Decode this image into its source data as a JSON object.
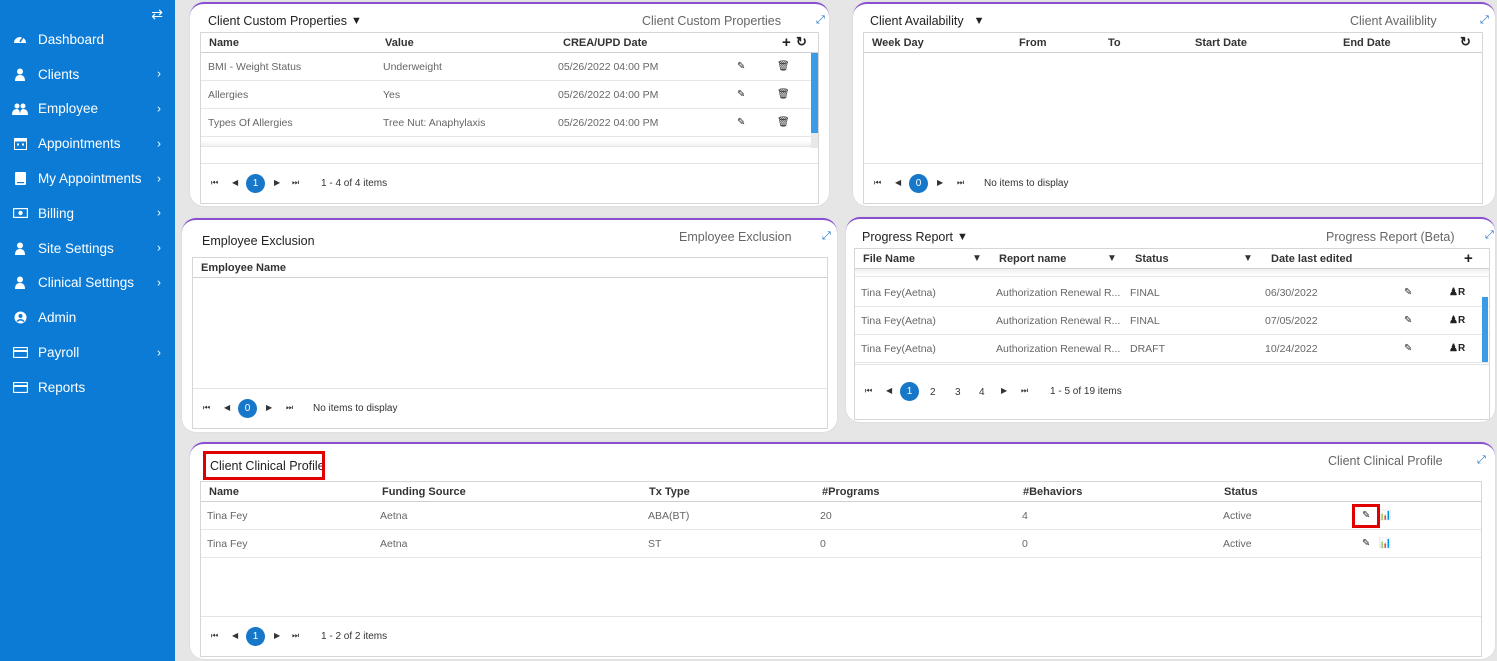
{
  "sidebar": {
    "toggle_icon": "swap-arrows-icon",
    "items": [
      {
        "label": "Dashboard",
        "icon": "dashboard-icon",
        "chevron": false
      },
      {
        "label": "Clients",
        "icon": "user-icon",
        "chevron": true
      },
      {
        "label": "Employee",
        "icon": "users-icon",
        "chevron": true
      },
      {
        "label": "Appointments",
        "icon": "calendar-icon",
        "chevron": true
      },
      {
        "label": "My Appointments",
        "icon": "book-icon",
        "chevron": true
      },
      {
        "label": "Billing",
        "icon": "money-icon",
        "chevron": true
      },
      {
        "label": "Site Settings",
        "icon": "user-icon",
        "chevron": true
      },
      {
        "label": "Clinical Settings",
        "icon": "user-icon",
        "chevron": true
      },
      {
        "label": "Admin",
        "icon": "user-circle-icon",
        "chevron": false
      },
      {
        "label": "Payroll",
        "icon": "credit-card-icon",
        "chevron": true
      },
      {
        "label": "Reports",
        "icon": "credit-card-icon",
        "chevron": false
      }
    ]
  },
  "custom_props": {
    "title": "Client Custom Properties",
    "right_title": "Client Custom Properties",
    "columns": [
      "Name",
      "Value",
      "CREA/UPD Date"
    ],
    "rows": [
      [
        "BMI - Weight Status",
        "Underweight",
        "05/26/2022 04:00 PM"
      ],
      [
        "Allergies",
        "Yes",
        "05/26/2022 04:00 PM"
      ],
      [
        "Types Of Allergies",
        "Tree Nut: Anaphylaxis",
        "05/26/2022 04:00 PM"
      ]
    ],
    "page": "1",
    "info": "1 - 4 of 4 items"
  },
  "availability": {
    "title": "Client Availability",
    "right_title": "Client Availiblity",
    "columns": [
      "Week Day",
      "From",
      "To",
      "Start Date",
      "End Date"
    ],
    "page": "0",
    "info": "No items to display"
  },
  "exclusion": {
    "title": "Employee Exclusion",
    "right_title": "Employee Exclusion",
    "columns": [
      "Employee Name"
    ],
    "page": "0",
    "info": "No items to display"
  },
  "progress": {
    "title": "Progress Report",
    "right_title": "Progress Report (Beta)",
    "columns": [
      "File Name",
      "Report name",
      "Status",
      "Date last edited"
    ],
    "rows": [
      [
        "Tina Fey(Aetna)",
        "Authorization Renewal R...",
        "FINAL",
        "06/30/2022"
      ],
      [
        "Tina Fey(Aetna)",
        "Authorization Renewal R...",
        "FINAL",
        "07/05/2022"
      ],
      [
        "Tina Fey(Aetna)",
        "Authorization Renewal R...",
        "DRAFT",
        "10/24/2022"
      ]
    ],
    "pages": [
      "1",
      "2",
      "3",
      "4"
    ],
    "info": "1 - 5 of 19 items"
  },
  "clinical": {
    "title": "Client Clinical Profile",
    "right_title": "Client Clinical Profile",
    "columns": [
      "Name",
      "Funding Source",
      "Tx Type",
      "#Programs",
      "#Behaviors",
      "Status"
    ],
    "rows": [
      [
        "Tina Fey",
        "Aetna",
        "ABA(BT)",
        "20",
        "4",
        "Active"
      ],
      [
        "Tina Fey",
        "Aetna",
        "ST",
        "0",
        "0",
        "Active"
      ]
    ],
    "page": "1",
    "info": "1 - 2 of 2 items"
  },
  "colors": {
    "sidebar": "#0b7bd6",
    "widget_accent": "#8a4fd0",
    "pager_current": "#1777c9",
    "highlight": "#e00000"
  }
}
